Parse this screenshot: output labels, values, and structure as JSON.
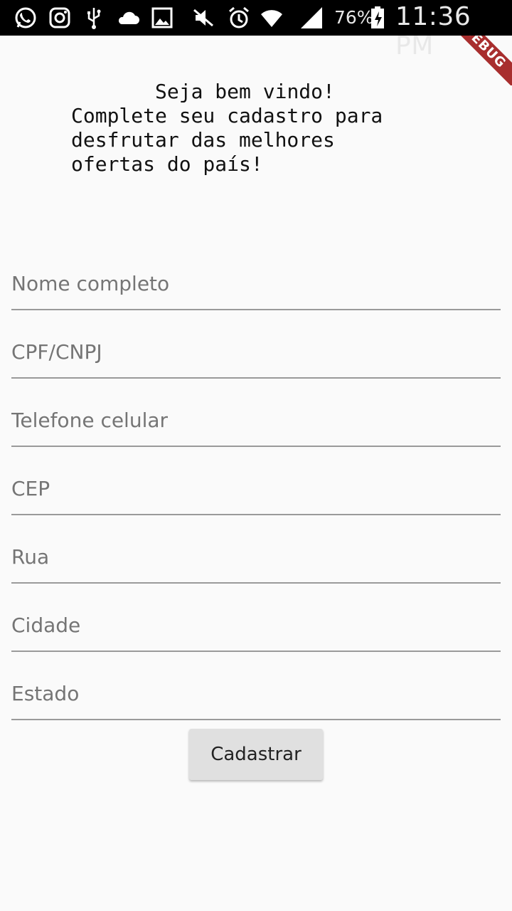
{
  "status_bar": {
    "battery": "76%",
    "time": "11:36 PM",
    "icons": [
      "whatsapp-icon",
      "instagram-icon",
      "usb-icon",
      "cloud-icon",
      "gallery-icon",
      "mute-icon",
      "alarm-icon",
      "wifi-icon",
      "signal-icon",
      "battery-charging-icon"
    ]
  },
  "debug_banner": "DEBUG",
  "welcome": {
    "text": "       Seja bem vindo!\nComplete seu cadastro para\ndesfrutar das melhores\nofertas do país!"
  },
  "form": {
    "fields": [
      {
        "placeholder": "Nome completo",
        "value": ""
      },
      {
        "placeholder": "CPF/CNPJ",
        "value": ""
      },
      {
        "placeholder": "Telefone celular",
        "value": ""
      },
      {
        "placeholder": "CEP",
        "value": ""
      },
      {
        "placeholder": "Rua",
        "value": ""
      },
      {
        "placeholder": "Cidade",
        "value": ""
      },
      {
        "placeholder": "Estado",
        "value": ""
      }
    ],
    "submit_label": "Cadastrar"
  }
}
